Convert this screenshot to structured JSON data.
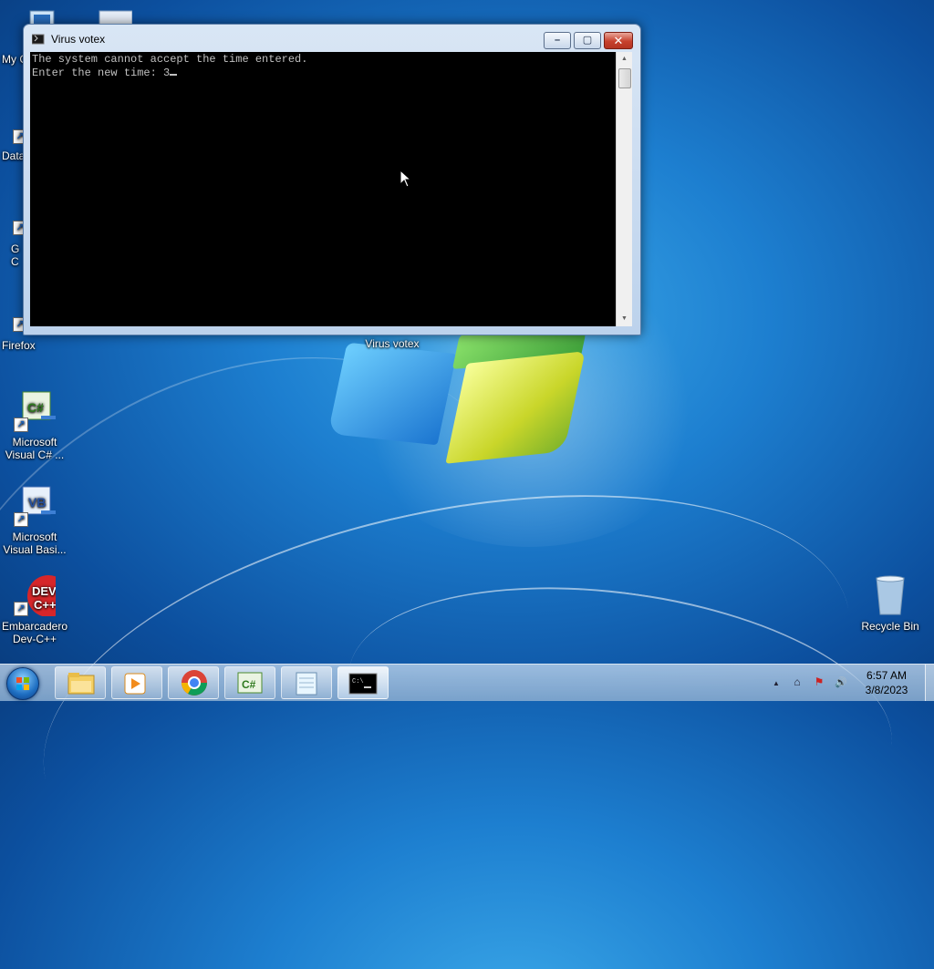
{
  "desktop": {
    "icons": [
      {
        "name": "my-computer-icon",
        "label": "My C"
      },
      {
        "name": "data-shortcut-icon",
        "label": "Data"
      },
      {
        "name": "google-chrome-icon",
        "label": "G\nC"
      },
      {
        "name": "firefox-icon",
        "label": "Firefox"
      },
      {
        "name": "visual-csharp-icon",
        "label": "Microsoft\nVisual C# ..."
      },
      {
        "name": "visual-basic-icon",
        "label": "Microsoft\nVisual Basi..."
      },
      {
        "name": "dev-cpp-icon",
        "label": "Embarcadero\nDev-C++"
      },
      {
        "name": "virus-votex-desktop-icon",
        "label": "Virus votex"
      },
      {
        "name": "recycle-bin-icon",
        "label": "Recycle Bin"
      }
    ]
  },
  "window": {
    "title": "Virus votex",
    "controls": {
      "minimize": "–",
      "maximize": "▢",
      "close": "✕"
    },
    "console": {
      "line1": "The system cannot accept the time entered.",
      "line2_prompt": "Enter the new time: ",
      "line2_input": "3"
    },
    "scroll_up": "▲",
    "scroll_down": "▼"
  },
  "taskbar": {
    "buttons": [
      {
        "name": "windows-explorer-icon"
      },
      {
        "name": "media-player-icon"
      },
      {
        "name": "chrome-icon"
      },
      {
        "name": "visual-csharp-icon"
      },
      {
        "name": "notepad-icon"
      },
      {
        "name": "command-prompt-icon",
        "active": true
      }
    ],
    "tray": {
      "show_hidden": "▲",
      "network": "⌂",
      "action_center": "⚑",
      "volume": "🔊"
    },
    "clock": {
      "time": "6:57 AM",
      "date": "3/8/2023"
    }
  },
  "colors": {
    "console_bg": "#000000",
    "console_text": "#c0c0c0",
    "close_button": "#c7412d",
    "desktop_blue": "#1d7fd0"
  }
}
